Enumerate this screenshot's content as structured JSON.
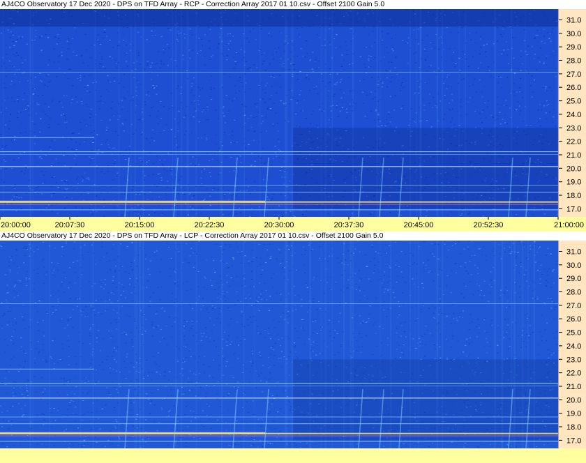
{
  "chart_data": [
    {
      "type": "heatmap",
      "title": "AJ4CO Observatory 17 Dec 2020  -  DPS on TFD Array  -  RCP  -  Correction Array 2017 01 10.csv  -  Offset 2100  Gain 5.0",
      "y_ticks": [
        "31.0",
        "30.0",
        "29.0",
        "28.0",
        "27.0",
        "26.0",
        "25.0",
        "24.0",
        "23.0",
        "22.0",
        "21.0",
        "20.0",
        "19.0",
        "18.0",
        "17.0"
      ],
      "y_values": [
        31,
        30,
        29,
        28,
        27,
        26,
        25,
        24,
        23,
        22,
        21,
        20,
        19,
        18,
        17
      ],
      "ylim": [
        16.4,
        31.8
      ],
      "x_ticks": [
        "20:00:00",
        "20:07:30",
        "20:15:00",
        "20:22:30",
        "20:30:00",
        "20:37:30",
        "20:45:00",
        "20:52:30",
        "21:00:00"
      ],
      "xlim": [
        "20:00:00",
        "21:00:00"
      ],
      "colors": {
        "background": "#1e4fd2",
        "dark": "#0c2b92",
        "bright": "#4fa6ff",
        "hot": "#ffe070"
      }
    },
    {
      "type": "heatmap",
      "title": "AJ4CO Observatory 17 Dec 2020  -  DPS on TFD Array  -  LCP  -  Correction Array 2017 01 10.csv  -  Offset 2100  Gain 5.0",
      "y_ticks": [
        "31.0",
        "30.0",
        "29.0",
        "28.0",
        "27.0",
        "26.0",
        "25.0",
        "24.0",
        "23.0",
        "22.0",
        "21.0",
        "20.0",
        "19.0",
        "18.0",
        "17.0"
      ],
      "y_values": [
        31,
        30,
        29,
        28,
        27,
        26,
        25,
        24,
        23,
        22,
        21,
        20,
        19,
        18,
        17
      ],
      "ylim": [
        16.4,
        31.8
      ],
      "x_ticks": [],
      "xlim": [
        "20:00:00",
        "21:00:00"
      ],
      "colors": {
        "background": "#2158d6",
        "dark": "#123a9e",
        "bright": "#55aaff",
        "hot": "#ffe070"
      }
    }
  ]
}
